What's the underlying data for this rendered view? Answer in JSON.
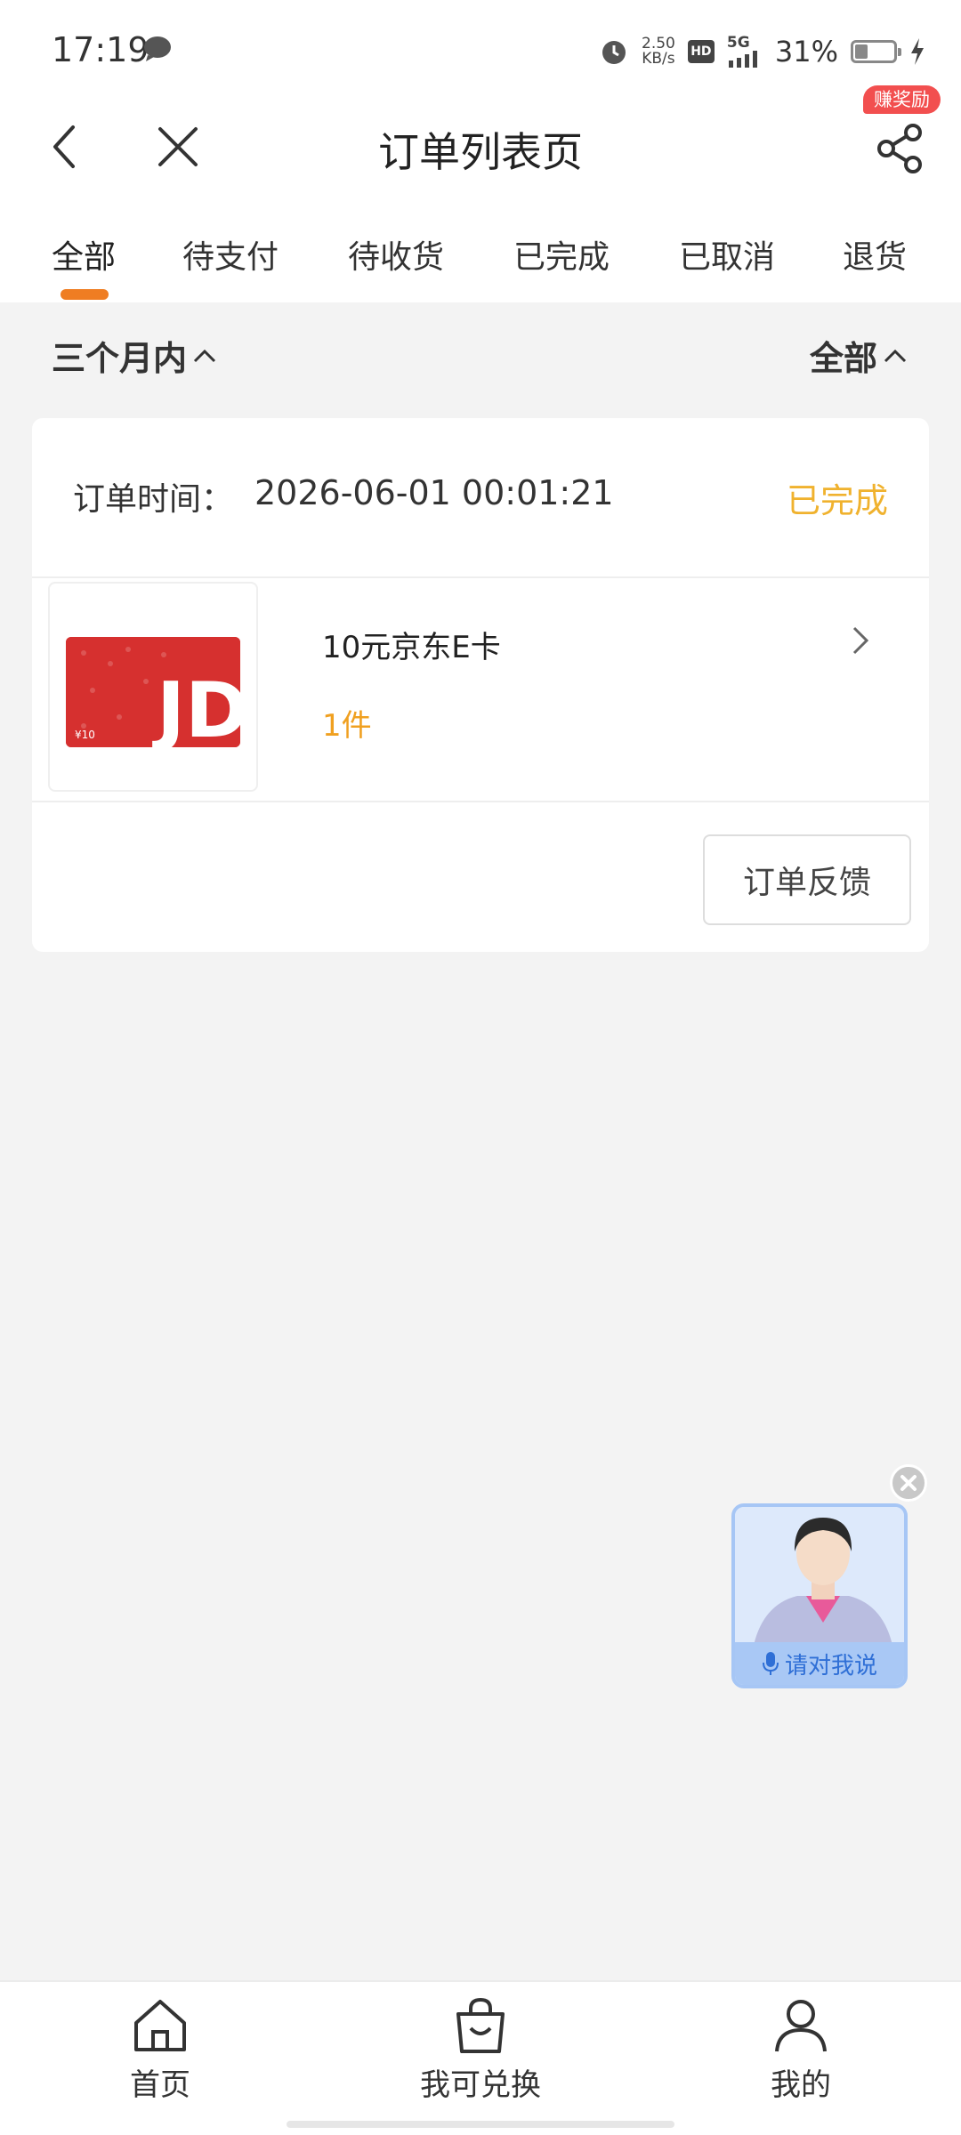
{
  "status_bar": {
    "time": "17:19",
    "speed_value": "2.50",
    "speed_unit": "KB/s",
    "hd": "HD",
    "network": "5G",
    "battery": "31%"
  },
  "header": {
    "title": "订单列表页",
    "reward_badge": "赚奖励",
    "icons": [
      "back-icon",
      "close-icon",
      "share-icon"
    ]
  },
  "tabs": [
    {
      "label": "全部",
      "active": true
    },
    {
      "label": "待支付",
      "active": false
    },
    {
      "label": "待收货",
      "active": false
    },
    {
      "label": "已完成",
      "active": false
    },
    {
      "label": "已取消",
      "active": false
    },
    {
      "label": "退货",
      "active": false
    }
  ],
  "filters": {
    "time_range": "三个月内",
    "order_type": "全部"
  },
  "order": {
    "time_label": "订单时间：",
    "time_value": "2026-06-01 00:01:21",
    "status": "已完成",
    "item_name": "10元京东E卡",
    "item_qty": "1件",
    "card_logo": "JD",
    "card_value": "¥10",
    "feedback_button": "订单反馈"
  },
  "assistant": {
    "label": "请对我说"
  },
  "bottom_nav": [
    {
      "label": "首页",
      "icon": "home-icon"
    },
    {
      "label": "我可兑换",
      "icon": "shopping-bag-icon"
    },
    {
      "label": "我的",
      "icon": "user-icon"
    }
  ],
  "colors": {
    "accent": "#ef7d22",
    "status_complete": "#f0b22e",
    "quantity": "#f0a020",
    "badge": "#f24f4f",
    "page_bg": "#f3f3f3"
  }
}
